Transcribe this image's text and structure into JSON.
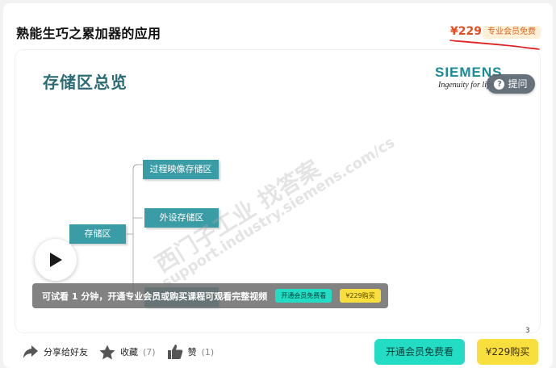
{
  "header": {
    "title": "熟能生巧之累加器的应用",
    "price": "¥229",
    "vip_tag": "专业会员免费"
  },
  "video": {
    "slide_title": "存储区总览",
    "logo": "SIEMENS",
    "slogan": "Ingenuity for life",
    "ask_button": "提问",
    "nodes": {
      "root": "存储区",
      "process_image": "过程映像存储区",
      "peripheral": "外设存储区"
    },
    "watermark": {
      "line1": "西门子工业  找答案",
      "line2": "support.industry.siemens.com/cs"
    },
    "trial": {
      "text": "可试看 1 分钟，开通专业会员或购买课程可观看完整视频",
      "vip_label": "开通会员免费看",
      "buy_label": "¥229购买"
    },
    "page_mark": "3"
  },
  "actions": {
    "share": "分享给好友",
    "favorite": "收藏",
    "favorite_count": "(7)",
    "like": "赞",
    "like_count": "(1)"
  },
  "buttons": {
    "vip": "开通会员免费看",
    "buy": "¥229购买"
  },
  "colors": {
    "accent_teal": "#22dcc4",
    "accent_yellow": "#f8df3d",
    "price_red": "#e84c1d",
    "node_teal": "#3a9ca5"
  }
}
